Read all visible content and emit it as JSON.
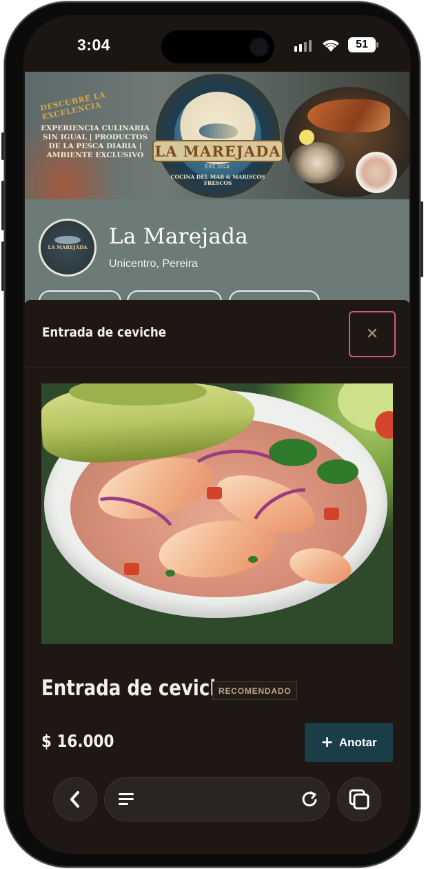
{
  "status_bar": {
    "time": "3:04",
    "battery": "51"
  },
  "banner": {
    "tagline": "DESCUBRE LA EXCELENCIA",
    "copy": "EXPERIENCIA CULINARIA SIN IGUAL | PRODUCTOS DE LA PESCA DIARIA | AMBIENTE EXCLUSIVO",
    "brand": "LA MAREJADA",
    "year": "EST. 2024",
    "subtitle": "COCINA DEL MAR & MARISCOS FRESCOS"
  },
  "restaurant": {
    "name": "La Marejada",
    "location": "Unicentro, Pereira",
    "avatar_text": "LA MAREJADA"
  },
  "modal": {
    "title": "Entrada de ceviche",
    "close_icon": "close-icon",
    "dish_name": "Entrada de ceviche",
    "badge": "RECOMENDADO",
    "price": "$ 16.000",
    "add_button": "Anotar"
  },
  "browser_toolbar": {
    "back_icon": "chevron-left-icon",
    "menu_icon": "hamburger-icon",
    "reload_icon": "reload-icon",
    "tabs_icon": "tabs-icon"
  },
  "colors": {
    "sheet_background": "#1e1713",
    "profile_background": "#6c7b77",
    "add_button": "#1a3d47",
    "close_focus_ring": "#d05a8c"
  }
}
